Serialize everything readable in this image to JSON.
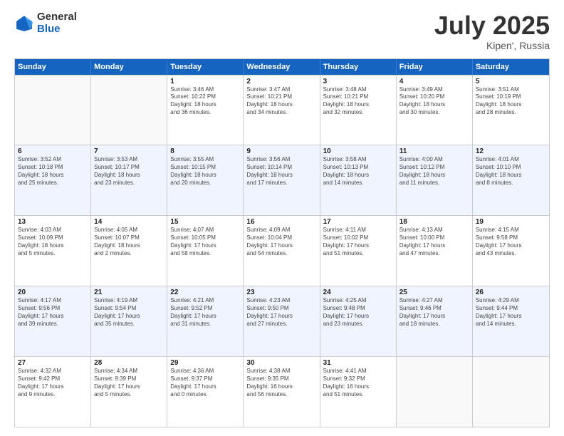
{
  "logo": {
    "general": "General",
    "blue": "Blue"
  },
  "title": {
    "month": "July 2025",
    "location": "Kipen', Russia"
  },
  "weekdays": [
    "Sunday",
    "Monday",
    "Tuesday",
    "Wednesday",
    "Thursday",
    "Friday",
    "Saturday"
  ],
  "weeks": [
    [
      {
        "day": "",
        "info": ""
      },
      {
        "day": "",
        "info": ""
      },
      {
        "day": "1",
        "info": "Sunrise: 3:46 AM\nSunset: 10:22 PM\nDaylight: 18 hours\nand 36 minutes."
      },
      {
        "day": "2",
        "info": "Sunrise: 3:47 AM\nSunset: 10:21 PM\nDaylight: 18 hours\nand 34 minutes."
      },
      {
        "day": "3",
        "info": "Sunrise: 3:48 AM\nSunset: 10:21 PM\nDaylight: 18 hours\nand 32 minutes."
      },
      {
        "day": "4",
        "info": "Sunrise: 3:49 AM\nSunset: 10:20 PM\nDaylight: 18 hours\nand 30 minutes."
      },
      {
        "day": "5",
        "info": "Sunrise: 3:51 AM\nSunset: 10:19 PM\nDaylight: 18 hours\nand 28 minutes."
      }
    ],
    [
      {
        "day": "6",
        "info": "Sunrise: 3:52 AM\nSunset: 10:18 PM\nDaylight: 18 hours\nand 25 minutes."
      },
      {
        "day": "7",
        "info": "Sunrise: 3:53 AM\nSunset: 10:17 PM\nDaylight: 18 hours\nand 23 minutes."
      },
      {
        "day": "8",
        "info": "Sunrise: 3:55 AM\nSunset: 10:15 PM\nDaylight: 18 hours\nand 20 minutes."
      },
      {
        "day": "9",
        "info": "Sunrise: 3:56 AM\nSunset: 10:14 PM\nDaylight: 18 hours\nand 17 minutes."
      },
      {
        "day": "10",
        "info": "Sunrise: 3:58 AM\nSunset: 10:13 PM\nDaylight: 18 hours\nand 14 minutes."
      },
      {
        "day": "11",
        "info": "Sunrise: 4:00 AM\nSunset: 10:12 PM\nDaylight: 18 hours\nand 11 minutes."
      },
      {
        "day": "12",
        "info": "Sunrise: 4:01 AM\nSunset: 10:10 PM\nDaylight: 18 hours\nand 8 minutes."
      }
    ],
    [
      {
        "day": "13",
        "info": "Sunrise: 4:03 AM\nSunset: 10:09 PM\nDaylight: 18 hours\nand 5 minutes."
      },
      {
        "day": "14",
        "info": "Sunrise: 4:05 AM\nSunset: 10:07 PM\nDaylight: 18 hours\nand 2 minutes."
      },
      {
        "day": "15",
        "info": "Sunrise: 4:07 AM\nSunset: 10:05 PM\nDaylight: 17 hours\nand 58 minutes."
      },
      {
        "day": "16",
        "info": "Sunrise: 4:09 AM\nSunset: 10:04 PM\nDaylight: 17 hours\nand 54 minutes."
      },
      {
        "day": "17",
        "info": "Sunrise: 4:11 AM\nSunset: 10:02 PM\nDaylight: 17 hours\nand 51 minutes."
      },
      {
        "day": "18",
        "info": "Sunrise: 4:13 AM\nSunset: 10:00 PM\nDaylight: 17 hours\nand 47 minutes."
      },
      {
        "day": "19",
        "info": "Sunrise: 4:15 AM\nSunset: 9:58 PM\nDaylight: 17 hours\nand 43 minutes."
      }
    ],
    [
      {
        "day": "20",
        "info": "Sunrise: 4:17 AM\nSunset: 9:56 PM\nDaylight: 17 hours\nand 39 minutes."
      },
      {
        "day": "21",
        "info": "Sunrise: 4:19 AM\nSunset: 9:54 PM\nDaylight: 17 hours\nand 35 minutes."
      },
      {
        "day": "22",
        "info": "Sunrise: 4:21 AM\nSunset: 9:52 PM\nDaylight: 17 hours\nand 31 minutes."
      },
      {
        "day": "23",
        "info": "Sunrise: 4:23 AM\nSunset: 9:50 PM\nDaylight: 17 hours\nand 27 minutes."
      },
      {
        "day": "24",
        "info": "Sunrise: 4:25 AM\nSunset: 9:48 PM\nDaylight: 17 hours\nand 23 minutes."
      },
      {
        "day": "25",
        "info": "Sunrise: 4:27 AM\nSunset: 9:46 PM\nDaylight: 17 hours\nand 18 minutes."
      },
      {
        "day": "26",
        "info": "Sunrise: 4:29 AM\nSunset: 9:44 PM\nDaylight: 17 hours\nand 14 minutes."
      }
    ],
    [
      {
        "day": "27",
        "info": "Sunrise: 4:32 AM\nSunset: 9:42 PM\nDaylight: 17 hours\nand 9 minutes."
      },
      {
        "day": "28",
        "info": "Sunrise: 4:34 AM\nSunset: 9:39 PM\nDaylight: 17 hours\nand 5 minutes."
      },
      {
        "day": "29",
        "info": "Sunrise: 4:36 AM\nSunset: 9:37 PM\nDaylight: 17 hours\nand 0 minutes."
      },
      {
        "day": "30",
        "info": "Sunrise: 4:38 AM\nSunset: 9:35 PM\nDaylight: 16 hours\nand 56 minutes."
      },
      {
        "day": "31",
        "info": "Sunrise: 4:41 AM\nSunset: 9:32 PM\nDaylight: 16 hours\nand 51 minutes."
      },
      {
        "day": "",
        "info": ""
      },
      {
        "day": "",
        "info": ""
      }
    ]
  ]
}
